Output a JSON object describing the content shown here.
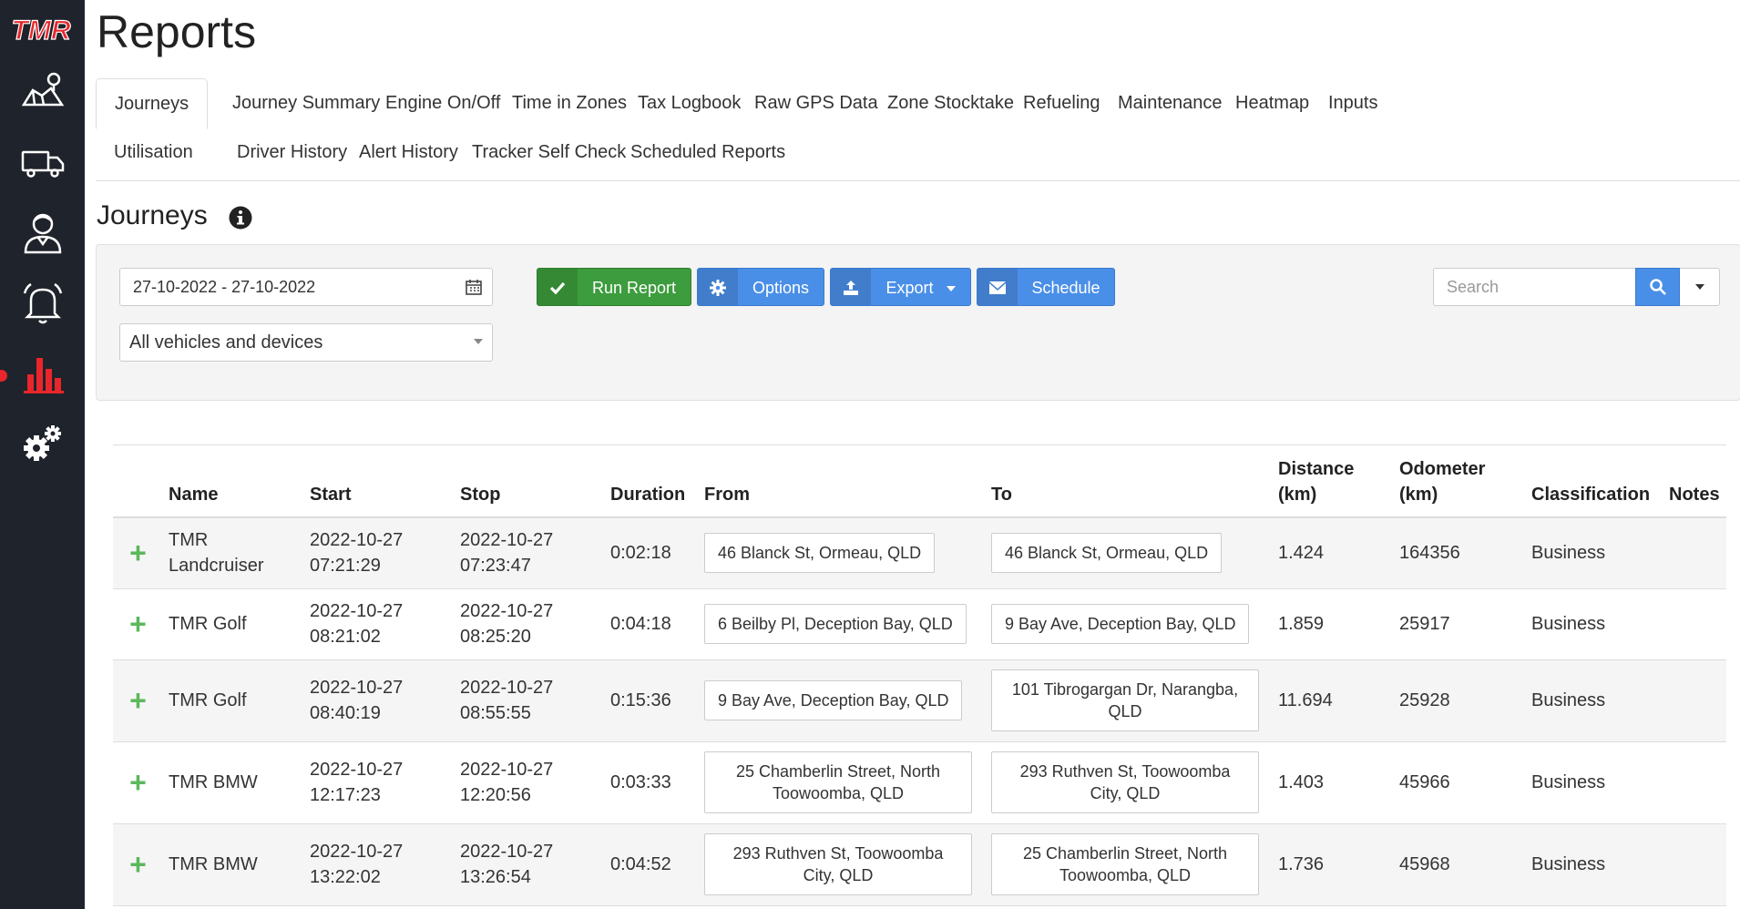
{
  "app": {
    "logo_text": "TMR"
  },
  "sidebar": {
    "items": [
      {
        "name": "map",
        "icon": "map-pin-icon"
      },
      {
        "name": "vehicles",
        "icon": "truck-icon"
      },
      {
        "name": "drivers",
        "icon": "driver-icon"
      },
      {
        "name": "alerts",
        "icon": "bell-icon"
      },
      {
        "name": "reports",
        "icon": "bar-chart-icon",
        "active": true
      },
      {
        "name": "settings",
        "icon": "gears-icon"
      }
    ],
    "active_color": "#e8262b"
  },
  "page": {
    "title": "Reports"
  },
  "tabs": [
    "Journeys",
    "Journey Summary",
    "Engine On/Off",
    "Time in Zones",
    "Tax Logbook",
    "Raw GPS Data",
    "Zone Stocktake",
    "Refueling",
    "Maintenance",
    "Heatmap",
    "Inputs",
    "Utilisation",
    "Driver History",
    "Alert History",
    "Tracker Self Check",
    "Scheduled Reports"
  ],
  "section": {
    "title": "Journeys"
  },
  "filters": {
    "date_range": "27-10-2022 - 27-10-2022",
    "vehicle_select": "All vehicles and devices"
  },
  "buttons": {
    "run_report": "Run Report",
    "options": "Options",
    "export": "Export",
    "schedule": "Schedule"
  },
  "search": {
    "placeholder": "Search"
  },
  "table": {
    "headers": {
      "name": "Name",
      "start": "Start",
      "stop": "Stop",
      "duration": "Duration",
      "from": "From",
      "to": "To",
      "distance_1": "Distance",
      "distance_2": "(km)",
      "odometer_1": "Odometer",
      "odometer_2": "(km)",
      "classification": "Classification",
      "notes": "Notes"
    },
    "rows": [
      {
        "expand": "+",
        "name": "TMR Landcruiser",
        "start_date": "2022-10-27",
        "start_time": "07:21:29",
        "stop_date": "2022-10-27",
        "stop_time": "07:23:47",
        "duration": "0:02:18",
        "from": "46 Blanck St, Ormeau, QLD",
        "to": "46 Blanck St, Ormeau, QLD",
        "distance": "1.424",
        "odometer": "164356",
        "classification": "Business",
        "notes": ""
      },
      {
        "expand": "+",
        "name": "TMR Golf",
        "start_date": "2022-10-27",
        "start_time": "08:21:02",
        "stop_date": "2022-10-27",
        "stop_time": "08:25:20",
        "duration": "0:04:18",
        "from": "6 Beilby Pl, Deception Bay, QLD",
        "to": "9 Bay Ave, Deception Bay, QLD",
        "distance": "1.859",
        "odometer": "25917",
        "classification": "Business",
        "notes": ""
      },
      {
        "expand": "+",
        "name": "TMR Golf",
        "start_date": "2022-10-27",
        "start_time": "08:40:19",
        "stop_date": "2022-10-27",
        "stop_time": "08:55:55",
        "duration": "0:15:36",
        "from": "9 Bay Ave, Deception Bay, QLD",
        "to": "101 Tibrogargan Dr, Narangba, QLD",
        "distance": "11.694",
        "odometer": "25928",
        "classification": "Business",
        "notes": ""
      },
      {
        "expand": "+",
        "name": "TMR BMW",
        "start_date": "2022-10-27",
        "start_time": "12:17:23",
        "stop_date": "2022-10-27",
        "stop_time": "12:20:56",
        "duration": "0:03:33",
        "from": "25 Chamberlin Street, North Toowoomba, QLD",
        "to": "293 Ruthven St, Toowoomba City, QLD",
        "distance": "1.403",
        "odometer": "45966",
        "classification": "Business",
        "notes": ""
      },
      {
        "expand": "+",
        "name": "TMR BMW",
        "start_date": "2022-10-27",
        "start_time": "13:22:02",
        "stop_date": "2022-10-27",
        "stop_time": "13:26:54",
        "duration": "0:04:52",
        "from": "293 Ruthven St, Toowoomba City, QLD",
        "to": "25 Chamberlin Street, North Toowoomba, QLD",
        "distance": "1.736",
        "odometer": "45968",
        "classification": "Business",
        "notes": ""
      }
    ]
  },
  "colors": {
    "sidebar_bg": "#1f232b",
    "run_report_green": "#3d9c3d",
    "primary_blue": "#4a8fe7",
    "expand_green": "#5cb85c",
    "brand_red": "#e8262b"
  }
}
